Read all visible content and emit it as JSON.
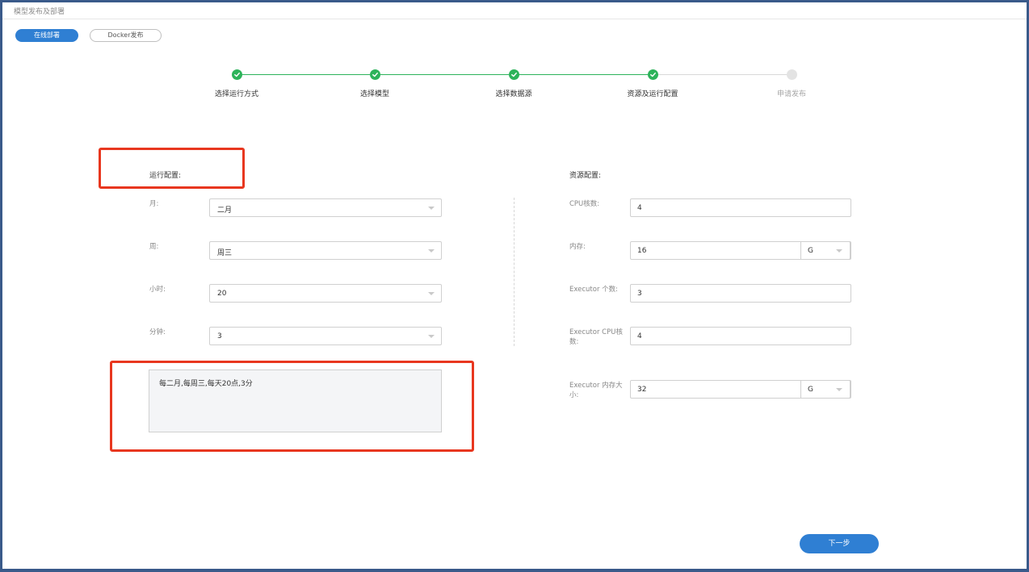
{
  "header": {
    "breadcrumb": "模型发布及部署"
  },
  "publish_tabs": {
    "online": "在线部署",
    "docker": "Docker发布"
  },
  "steps": [
    {
      "label": "选择运行方式",
      "status": "done"
    },
    {
      "label": "选择模型",
      "status": "done"
    },
    {
      "label": "选择数据源",
      "status": "done"
    },
    {
      "label": "资源及运行配置",
      "status": "done"
    },
    {
      "label": "申请发布",
      "status": "todo"
    }
  ],
  "run_config": {
    "title": "运行配置:",
    "month": {
      "label": "月:",
      "value": "二月"
    },
    "week": {
      "label": "周:",
      "value": "周三"
    },
    "hour": {
      "label": "小时:",
      "value": "20"
    },
    "minute": {
      "label": "分钟:",
      "value": "3"
    },
    "summary": "每二月,每周三,每天20点,3分"
  },
  "resource_config": {
    "title": "资源配置:",
    "cpu": {
      "label": "CPU核数:",
      "value": "4"
    },
    "memory": {
      "label": "内存:",
      "value": "16",
      "unit": "G"
    },
    "executor_count": {
      "label": "Executor 个数:",
      "value": "3"
    },
    "executor_cpu": {
      "label_line1": "Executor CPU核",
      "label_line2": "数:",
      "value": "4"
    },
    "executor_memory": {
      "label_line1": "Executor 内存大",
      "label_line2": "小:",
      "value": "32",
      "unit": "G"
    }
  },
  "actions": {
    "next": "下一步"
  },
  "colors": {
    "primary": "#2f7fd3",
    "success": "#2db35a",
    "annotation": "#e8371f",
    "frame": "#3a5a8a"
  }
}
